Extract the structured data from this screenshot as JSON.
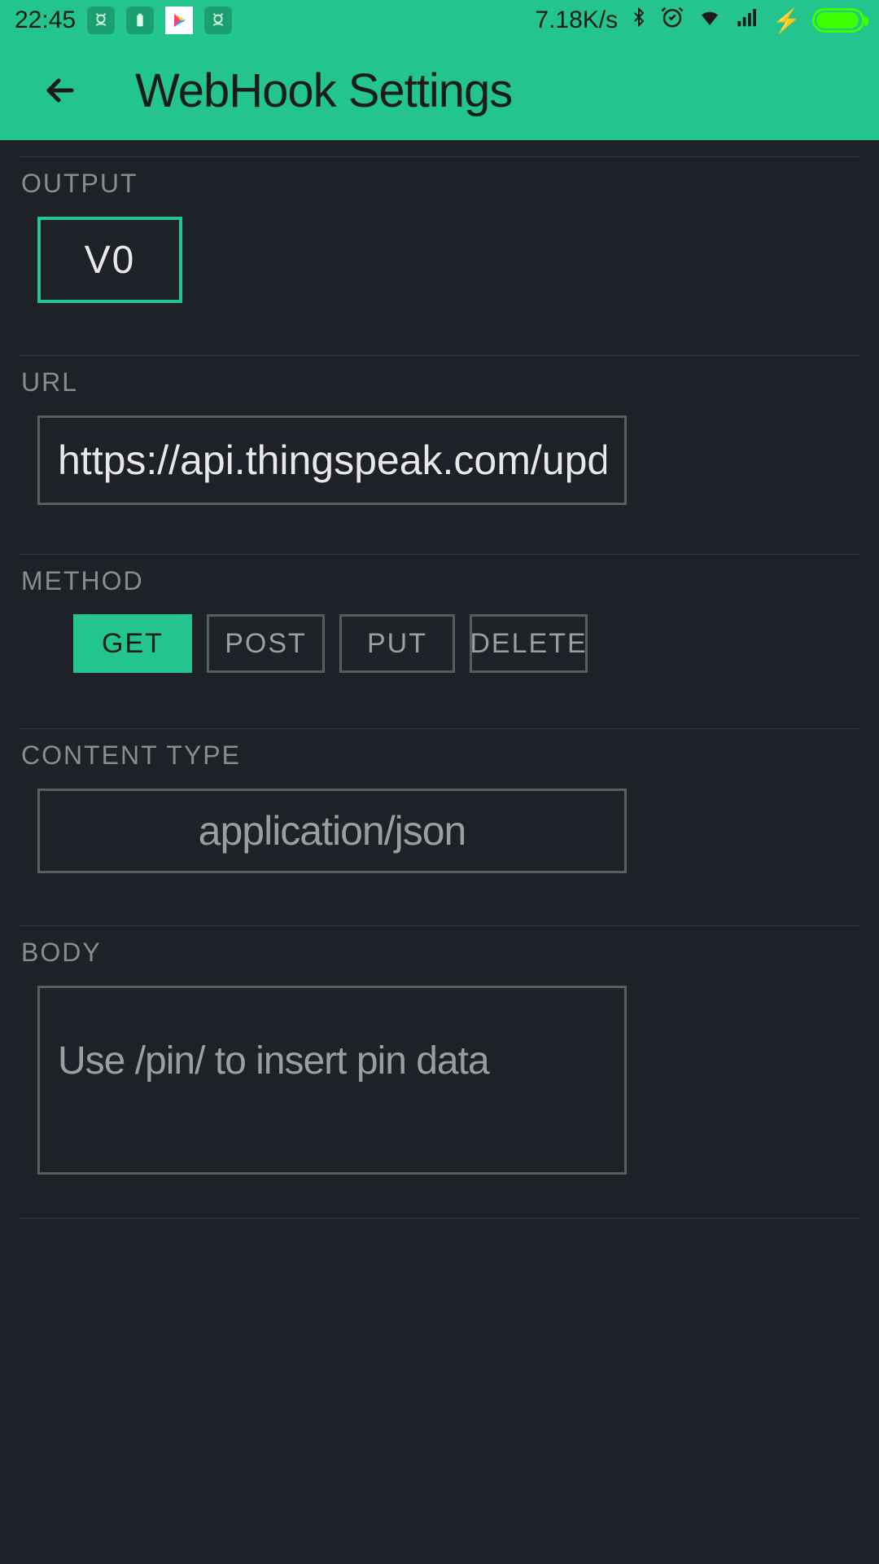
{
  "status": {
    "time": "22:45",
    "speed": "7.18K/s"
  },
  "appbar": {
    "title": "WebHook Settings"
  },
  "output": {
    "label": "OUTPUT",
    "value": "V0"
  },
  "url": {
    "label": "URL",
    "value": "https://api.thingspeak.com/update"
  },
  "method": {
    "label": "METHOD",
    "selected": "GET",
    "options": {
      "get": "GET",
      "post": "POST",
      "put": "PUT",
      "delete": "DELETE"
    }
  },
  "content_type": {
    "label": "CONTENT TYPE",
    "value": "application/json"
  },
  "body": {
    "label": "BODY",
    "placeholder": "Use /pin/ to insert pin data",
    "value": ""
  }
}
